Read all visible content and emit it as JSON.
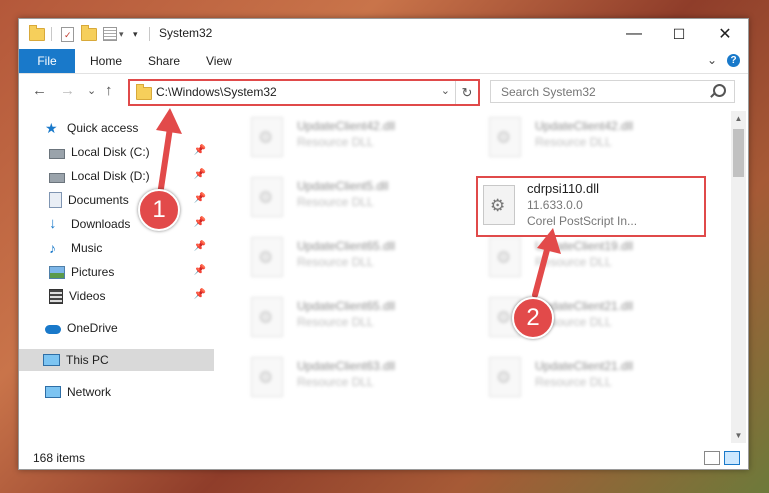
{
  "window": {
    "title": "System32",
    "controls": {
      "minimize": "—",
      "maximize": "☐",
      "close": "✕"
    }
  },
  "ribbon": {
    "tabs": [
      "File",
      "Home",
      "Share",
      "View"
    ],
    "expand_glyph": "⌄",
    "help_glyph": "?"
  },
  "address_bar": {
    "path": "C:\\Windows\\System32",
    "dropdown_glyph": "⌄",
    "refresh_glyph": "↻"
  },
  "nav_buttons": {
    "back": "←",
    "forward": "→",
    "recent": "⌄",
    "up": "↑"
  },
  "search": {
    "placeholder": "Search System32"
  },
  "nav_pane": {
    "items": [
      {
        "label": "Quick access",
        "icon": "star-icon",
        "pinned": false
      },
      {
        "label": "Local Disk (C:)",
        "icon": "drive-icon",
        "pinned": true
      },
      {
        "label": "Local Disk (D:)",
        "icon": "drive-icon",
        "pinned": true
      },
      {
        "label": "Documents",
        "icon": "documents-icon",
        "pinned": true
      },
      {
        "label": "Downloads",
        "icon": "download-icon",
        "pinned": true
      },
      {
        "label": "Music",
        "icon": "music-icon",
        "pinned": true
      },
      {
        "label": "Pictures",
        "icon": "pictures-icon",
        "pinned": true
      },
      {
        "label": "Videos",
        "icon": "videos-icon",
        "pinned": true
      },
      {
        "label": "OneDrive",
        "icon": "cloud-icon",
        "pinned": false
      },
      {
        "label": "This PC",
        "icon": "computer-icon",
        "pinned": false
      },
      {
        "label": "Network",
        "icon": "network-icon",
        "pinned": false
      }
    ],
    "pin_glyph": "📌"
  },
  "files": {
    "col1": [
      {
        "name": "UpdateClient42.dll",
        "type": "Resource DLL"
      },
      {
        "name": "UpdateClient5.dll",
        "type": "Resource DLL"
      },
      {
        "name": "UpdateClient65.dll",
        "type": "Resource DLL"
      },
      {
        "name": "UpdateClient65.dll",
        "type": "Resource DLL"
      },
      {
        "name": "UpdateClient63.dll",
        "type": "Resource DLL"
      }
    ],
    "col2": [
      {
        "name": "UpdateClient42.dll",
        "type": "Resource DLL"
      },
      {
        "name": "UpdateClient19.dll",
        "type": "Resource DLL"
      },
      {
        "name": "UpdateClient21.dll",
        "type": "Resource DLL"
      },
      {
        "name": "UpdateClient21.dll",
        "type": "Resource DLL"
      }
    ],
    "highlighted": {
      "name": "cdrpsi110.dll",
      "version": "11.633.0.0",
      "description": "Corel PostScript In..."
    }
  },
  "status_bar": {
    "item_count": "168 items"
  },
  "callouts": [
    "1",
    "2"
  ],
  "colors": {
    "accent": "#1979ca",
    "callout": "#e24a4a"
  }
}
